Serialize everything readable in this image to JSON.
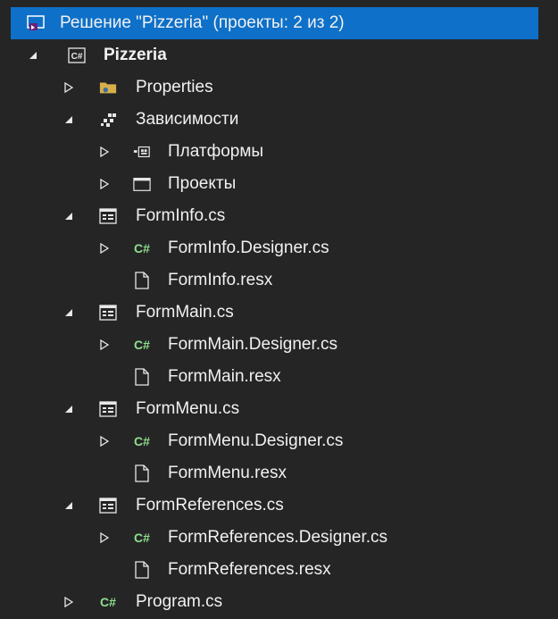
{
  "solution": {
    "label": "Решение \"Pizzeria\" (проекты: 2 из 2)"
  },
  "project": {
    "label": "Pizzeria",
    "icon": "csharp-project-icon"
  },
  "items": [
    {
      "label": "Properties",
      "icon": "properties-folder-icon"
    },
    {
      "label": "Зависимости",
      "icon": "dependencies-icon"
    },
    {
      "label": "Платформы",
      "icon": "platforms-icon"
    },
    {
      "label": "Проекты",
      "icon": "projects-icon"
    },
    {
      "label": "FormInfo.cs",
      "icon": "form-icon"
    },
    {
      "label": "FormInfo.Designer.cs",
      "icon": "csharp-file-icon"
    },
    {
      "label": "FormInfo.resx",
      "icon": "resx-file-icon"
    },
    {
      "label": "FormMain.cs",
      "icon": "form-icon"
    },
    {
      "label": "FormMain.Designer.cs",
      "icon": "csharp-file-icon"
    },
    {
      "label": "FormMain.resx",
      "icon": "resx-file-icon"
    },
    {
      "label": "FormMenu.cs",
      "icon": "form-icon"
    },
    {
      "label": "FormMenu.Designer.cs",
      "icon": "csharp-file-icon"
    },
    {
      "label": "FormMenu.resx",
      "icon": "resx-file-icon"
    },
    {
      "label": "FormReferences.cs",
      "icon": "form-icon"
    },
    {
      "label": "FormReferences.Designer.cs",
      "icon": "csharp-file-icon"
    },
    {
      "label": "FormReferences.resx",
      "icon": "resx-file-icon"
    },
    {
      "label": "Program.cs",
      "icon": "csharp-file-icon"
    }
  ],
  "glyphs": {
    "csharp": "C#"
  },
  "colors": {
    "selection": "#0e70c8",
    "background": "#252526",
    "text": "#f1f1f1",
    "csharp": "#8ee08e",
    "properties": "#d8b04a"
  }
}
